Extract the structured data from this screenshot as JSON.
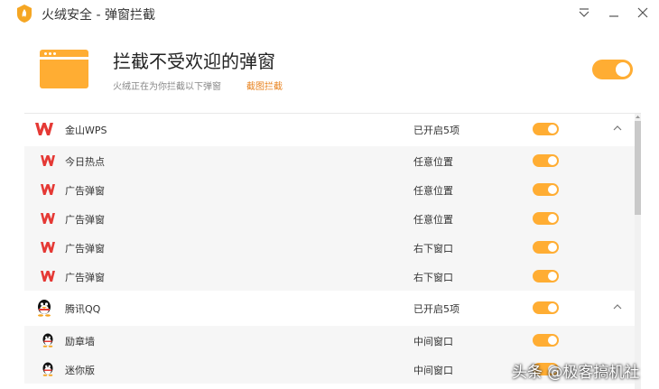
{
  "window": {
    "title": "火绒安全 - 弹窗拦截"
  },
  "header": {
    "title": "拦截不受欢迎的弹窗",
    "subtitle": "火绒正在为你拦截以下弹窗",
    "link": "截图拦截",
    "master_toggle": true
  },
  "groups": [
    {
      "name": "金山WPS",
      "status": "已开启5项",
      "icon": "wps-icon",
      "items": [
        {
          "name": "今日热点",
          "position": "任意位置"
        },
        {
          "name": "广告弹窗",
          "position": "任意位置"
        },
        {
          "name": "广告弹窗",
          "position": "任意位置"
        },
        {
          "name": "广告弹窗",
          "position": "右下窗口"
        },
        {
          "name": "广告弹窗",
          "position": "右下窗口"
        }
      ]
    },
    {
      "name": "腾讯QQ",
      "status": "已开启5项",
      "icon": "qq-penguin-icon",
      "items": [
        {
          "name": "励章墙",
          "position": "中间窗口"
        },
        {
          "name": "迷你版",
          "position": "中间窗口"
        }
      ]
    }
  ],
  "watermark": "头条 @极客搞机社",
  "colors": {
    "accent": "#ffad33",
    "link": "#e8821e",
    "wps_red": "#e53935"
  }
}
